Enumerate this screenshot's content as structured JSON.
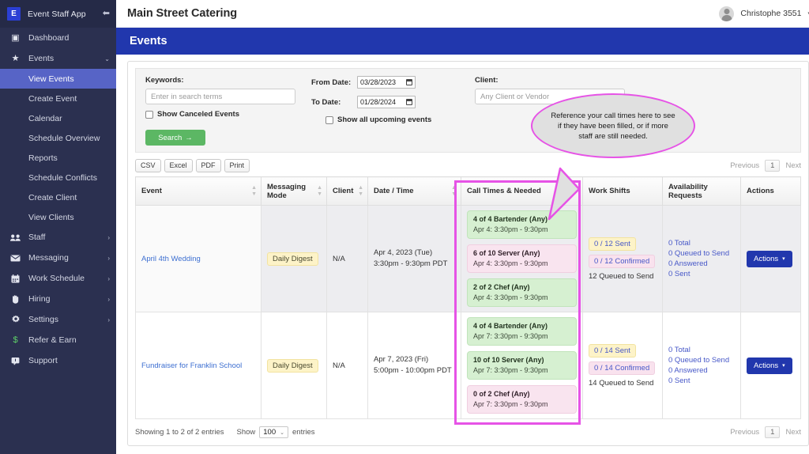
{
  "sidebar": {
    "logo_initial": "E",
    "brand": "Event Staff App",
    "collapse_icon": "collapse-icon",
    "items": [
      {
        "label": "Dashboard",
        "icon": "dashboard-icon",
        "glyph": "▣",
        "caret": ""
      },
      {
        "label": "Events",
        "icon": "star-icon",
        "glyph": "★",
        "caret": "⌄"
      }
    ],
    "sub_items": [
      {
        "label": "View Events",
        "active": true
      },
      {
        "label": "Create Event",
        "active": false
      },
      {
        "label": "Calendar",
        "active": false
      },
      {
        "label": "Schedule Overview",
        "active": false
      },
      {
        "label": "Reports",
        "active": false
      },
      {
        "label": "Schedule Conflicts",
        "active": false
      },
      {
        "label": "Create Client",
        "active": false
      },
      {
        "label": "View Clients",
        "active": false
      }
    ],
    "lower_items": [
      {
        "label": "Staff",
        "icon": "people-icon",
        "glyph": "👥",
        "caret": "›"
      },
      {
        "label": "Messaging",
        "icon": "envelope-icon",
        "glyph": "✉",
        "caret": "›"
      },
      {
        "label": "Work Schedule",
        "icon": "calendar-icon",
        "glyph": "▦",
        "caret": "›"
      },
      {
        "label": "Hiring",
        "icon": "hand-icon",
        "glyph": "✋",
        "caret": "›"
      },
      {
        "label": "Settings",
        "icon": "gear-icon",
        "glyph": "⚙",
        "caret": "›"
      },
      {
        "label": "Refer & Earn",
        "icon": "dollar-icon",
        "glyph": "$",
        "caret": ""
      },
      {
        "label": "Support",
        "icon": "support-chat-icon",
        "glyph": "⊡",
        "caret": ""
      }
    ]
  },
  "topbar": {
    "title": "Main Street Catering",
    "user_name": "Christophe 3551",
    "user_caret": "▾",
    "avatar_icon": "user-avatar-icon"
  },
  "page_header": {
    "title": "Events"
  },
  "filters": {
    "keywords_label": "Keywords:",
    "keywords_placeholder": "Enter in search terms",
    "keywords_value": "",
    "show_canceled_label": "Show Canceled Events",
    "search_label": "Search",
    "search_arrow": "→",
    "from_date_label": "From Date:",
    "from_date_value": "03/28/2023",
    "to_date_label": "To Date:",
    "to_date_value": "01/28/2024",
    "show_upcoming_label": "Show all upcoming events",
    "client_label": "Client:",
    "client_value": "Any Client or Vendor"
  },
  "export_buttons": [
    "CSV",
    "Excel",
    "PDF",
    "Print"
  ],
  "pagination_top": {
    "previous": "Previous",
    "page": "1",
    "next": "Next"
  },
  "pagination_bottom": {
    "previous": "Previous",
    "page": "1",
    "next": "Next"
  },
  "table": {
    "columns": [
      "Event",
      "Messaging Mode",
      "Client",
      "Date / Time",
      "Call Times & Needed",
      "Work Shifts",
      "Availability Requests",
      "Actions"
    ],
    "rows": [
      {
        "event": "April 4th Wedding",
        "messaging_mode": "Daily Digest",
        "client": "N/A",
        "date": "Apr 4, 2023 (Tue)",
        "time": "3:30pm - 9:30pm PDT",
        "call_times": [
          {
            "title": "4 of 4 Bartender (Any)",
            "when": "Apr 4: 3:30pm - 9:30pm",
            "status": "ok"
          },
          {
            "title": "6 of 10 Server (Any)",
            "when": "Apr 4: 3:30pm - 9:30pm",
            "status": "need"
          },
          {
            "title": "2 of 2 Chef (Any)",
            "when": "Apr 4: 3:30pm - 9:30pm",
            "status": "ok"
          }
        ],
        "work_shifts": {
          "sent": "0 / 12 Sent",
          "confirmed": "0 / 12 Confirmed",
          "queued": "12 Queued to Send"
        },
        "availability": [
          "0 Total",
          "0 Queued to Send",
          "0 Answered",
          "0 Sent"
        ],
        "actions_label": "Actions",
        "actions_caret": "▾"
      },
      {
        "event": "Fundraiser for Franklin School",
        "messaging_mode": "Daily Digest",
        "client": "N/A",
        "date": "Apr 7, 2023 (Fri)",
        "time": "5:00pm - 10:00pm PDT",
        "call_times": [
          {
            "title": "4 of 4 Bartender (Any)",
            "when": "Apr 7: 3:30pm - 9:30pm",
            "status": "ok"
          },
          {
            "title": "10 of 10 Server (Any)",
            "when": "Apr 7: 3:30pm - 9:30pm",
            "status": "ok"
          },
          {
            "title": "0 of 2 Chef (Any)",
            "when": "Apr 7: 3:30pm - 9:30pm",
            "status": "need"
          }
        ],
        "work_shifts": {
          "sent": "0 / 14 Sent",
          "confirmed": "0 / 14 Confirmed",
          "queued": "14 Queued to Send"
        },
        "availability": [
          "0 Total",
          "0 Queued to Send",
          "0 Answered",
          "0 Sent"
        ],
        "actions_label": "Actions",
        "actions_caret": "▾"
      }
    ]
  },
  "footer": {
    "showing": "Showing 1 to 2 of 2 entries",
    "show_label": "Show",
    "show_value": "100",
    "entries_label": "entries",
    "show_caret": "⌄"
  },
  "annotation": {
    "callout_text": "Reference your call times here to see if they have been filled, or if more staff are still needed.",
    "highlight_color": "#e653e6"
  }
}
